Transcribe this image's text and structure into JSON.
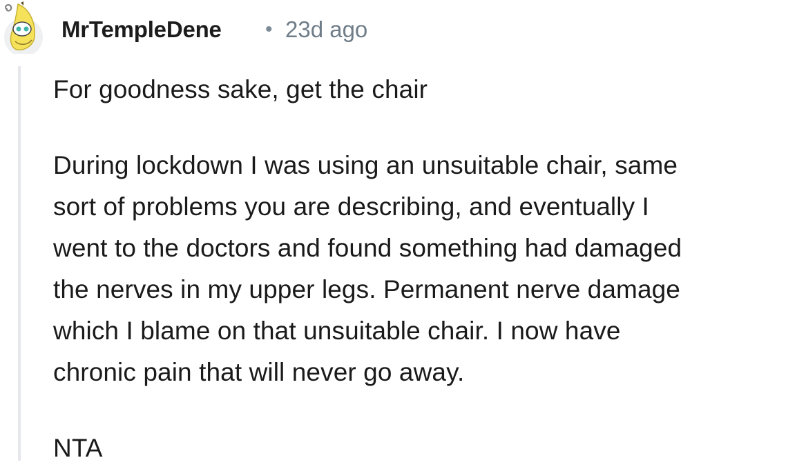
{
  "comment": {
    "author": "MrTempleDene",
    "separator": "•",
    "timestamp": "23d ago",
    "avatar_icon": "banana-snoo-avatar-icon",
    "paragraphs": [
      "For goodness sake, get the chair",
      "During lockdown I was using an unsuitable chair, same\nsort of problems you are describing, and eventually I\nwent to the doctors and found something had damaged\nthe nerves in my upper legs. Permanent nerve damage\nwhich I blame on that unsuitable chair. I now have\nchronic pain that will never go away.",
      "NTA"
    ]
  },
  "colors": {
    "username": "#1c1c1c",
    "meta": "#6f7d89",
    "body": "#1a1a1b",
    "thread_line": "#e5e7ea",
    "avatar_yellow": "#f6e15a",
    "avatar_teal": "#3fb6a8"
  }
}
